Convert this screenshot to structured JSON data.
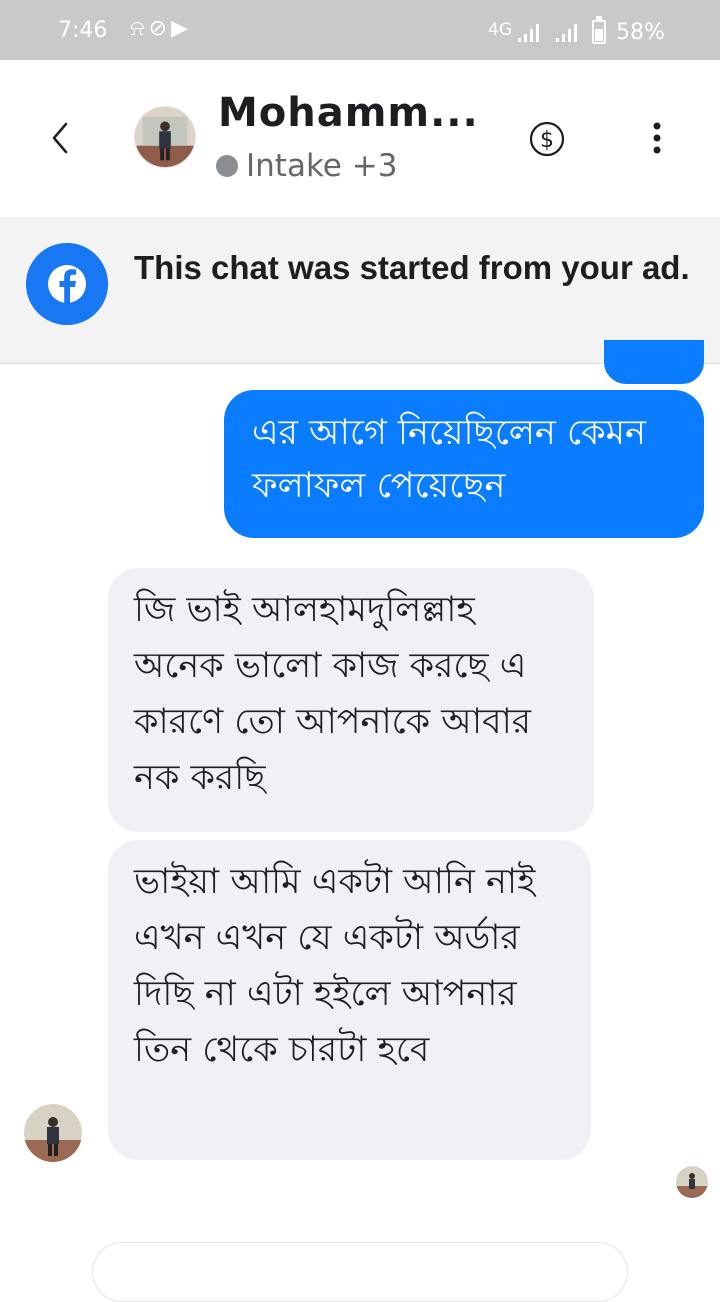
{
  "status_bar": {
    "time": "7:46",
    "network": "4G",
    "battery": "58%"
  },
  "header": {
    "contact_name": "Mohamm...",
    "label": "Intake +3"
  },
  "banner": {
    "text": "This chat was started from your ad."
  },
  "messages": [
    {
      "direction": "outgoing",
      "text": "এর আগে নিয়েছিলেন কেমন ফলাফল পেয়েছেন"
    },
    {
      "direction": "incoming",
      "text": "জি ভাই আলহামদুলিল্লাহ অনেক ভালো কাজ করছে এ কারণে তো আপনাকে আবার নক করছি"
    },
    {
      "direction": "incoming",
      "text": "ভাইয়া আমি একটা আনি নাই এখন এখন যে একটা অর্ডার দিছি না এটা হইলে আপনার তিন থেকে চারটা হবে"
    }
  ],
  "colors": {
    "accent": "#0a7cff",
    "facebook_blue": "#1877f2",
    "incoming_bubble": "#f0f1f5"
  },
  "icons": [
    "back-icon",
    "dollar-icon",
    "more-options-icon",
    "facebook-icon"
  ]
}
